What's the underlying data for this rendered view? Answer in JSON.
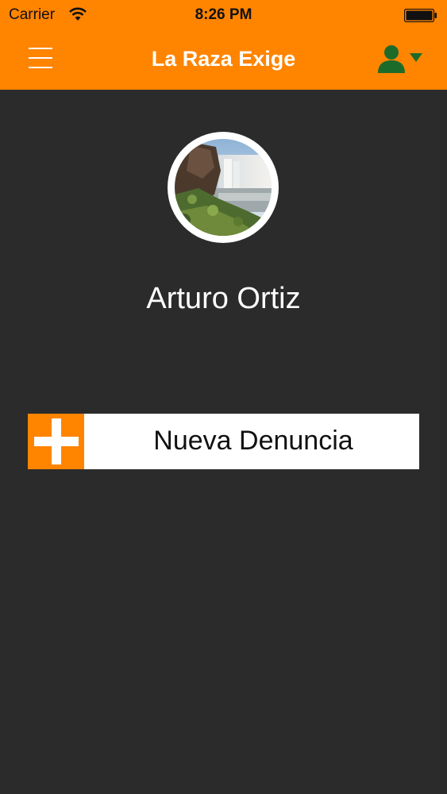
{
  "status_bar": {
    "carrier": "Carrier",
    "time": "8:26 PM",
    "wifi_icon": "wifi-icon",
    "battery_icon": "battery-icon"
  },
  "nav": {
    "title": "La Raza Exige",
    "menu_icon": "hamburger-menu-icon",
    "user_icon": "user-icon",
    "caret_icon": "caret-down-icon"
  },
  "profile": {
    "name": "Arturo Ortiz",
    "avatar_description": "avatar"
  },
  "actions": {
    "new_complaint_label": "Nueva Denuncia",
    "plus_icon": "plus-icon"
  },
  "colors": {
    "header": "#ff8400",
    "background": "#2b2b2c",
    "user_icon": "#1d6b2a"
  }
}
